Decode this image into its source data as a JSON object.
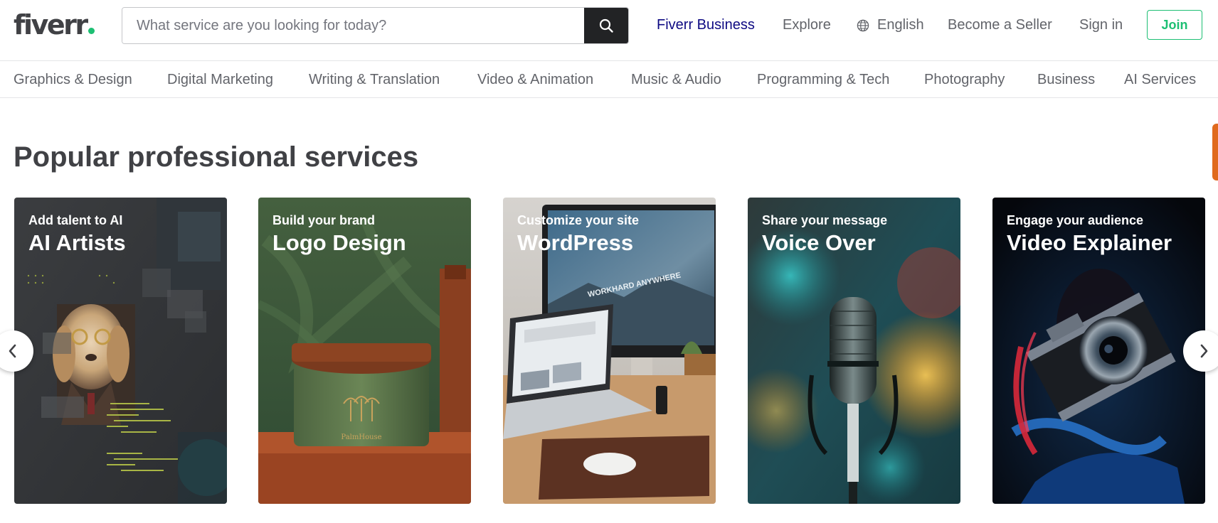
{
  "header": {
    "logo_text": "fiverr",
    "logo_dot_color": "#1dbf73",
    "search": {
      "placeholder": "What service are you looking for today?",
      "value": ""
    },
    "nav": {
      "business": "Fiverr Business",
      "explore": "Explore",
      "language": "English",
      "become_seller": "Become a Seller",
      "sign_in": "Sign in",
      "join": "Join"
    }
  },
  "categories": [
    "Graphics & Design",
    "Digital Marketing",
    "Writing & Translation",
    "Video & Animation",
    "Music & Audio",
    "Programming & Tech",
    "Photography",
    "Business",
    "AI Services"
  ],
  "section": {
    "title": "Popular professional services"
  },
  "cards": [
    {
      "subtitle": "Add talent to AI",
      "title": "AI Artists",
      "image": "ai-artist-dog-portrait"
    },
    {
      "subtitle": "Build your brand",
      "title": "Logo Design",
      "image": "palm-house-jar-branding"
    },
    {
      "subtitle": "Customize your site",
      "title": "WordPress",
      "image": "laptop-and-monitor-desk"
    },
    {
      "subtitle": "Share your message",
      "title": "Voice Over",
      "image": "studio-microphone"
    },
    {
      "subtitle": "Engage your audience",
      "title": "Video Explainer",
      "image": "hand-with-camera"
    }
  ],
  "image_text": {
    "monitor": "WORKHARD ANYWHERE",
    "jar_brand": "PalmHouse"
  },
  "colors": {
    "brand_green": "#1dbf73",
    "business_link": "#0e0a83",
    "text": "#404145",
    "muted_text": "#62646a"
  },
  "icons": {
    "search": "search-icon",
    "language": "globe-icon",
    "carousel_prev": "chevron-left-icon",
    "carousel_next": "chevron-right-icon"
  }
}
